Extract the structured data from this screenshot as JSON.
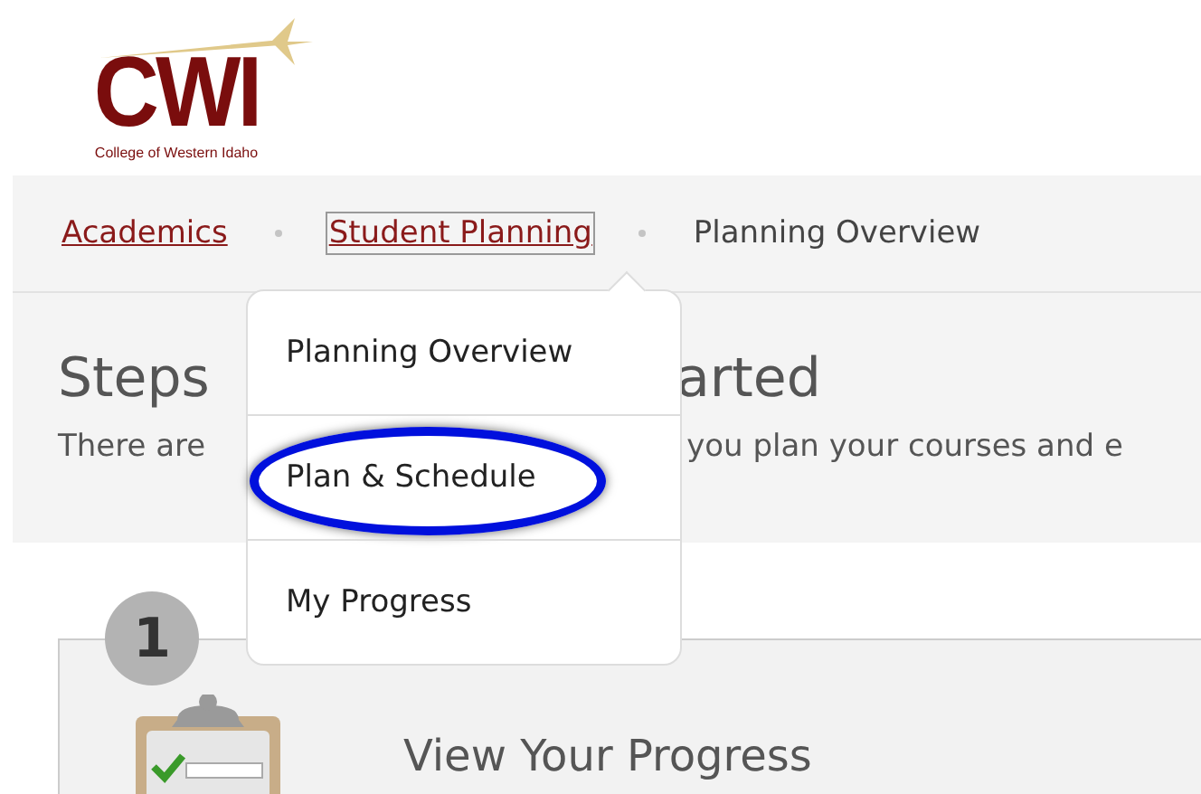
{
  "logo": {
    "name": "CWI",
    "tagline": "College of Western Idaho"
  },
  "breadcrumbs": [
    {
      "label": "Academics",
      "kind": "link",
      "focused": false
    },
    {
      "label": "Student Planning",
      "kind": "link",
      "focused": true
    },
    {
      "label": "Planning Overview",
      "kind": "current",
      "focused": false
    }
  ],
  "menu": {
    "items": [
      {
        "label": "Planning Overview",
        "circled": false
      },
      {
        "label": "Plan & Schedule",
        "circled": true
      },
      {
        "label": "My Progress",
        "circled": false
      }
    ]
  },
  "intro": {
    "heading_parts": [
      "Steps",
      "arted"
    ],
    "text_parts": [
      "There are",
      "you plan your courses and e"
    ]
  },
  "steps": [
    {
      "number": "1",
      "title": "View Your Progress"
    }
  ]
}
